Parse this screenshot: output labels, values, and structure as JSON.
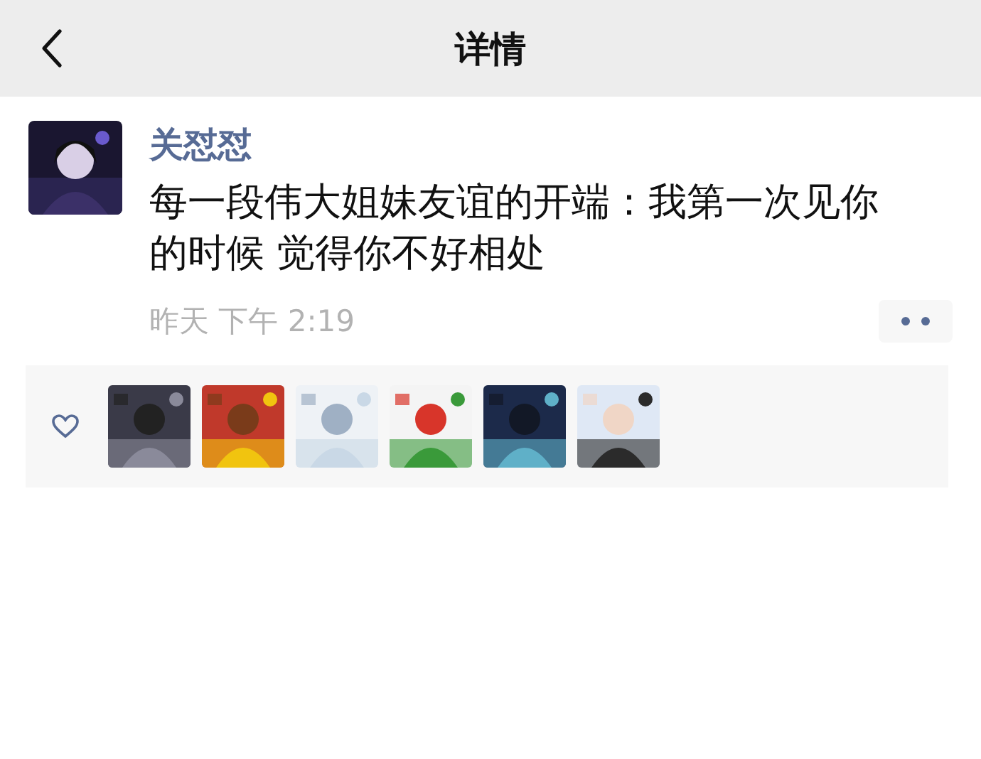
{
  "window": {
    "title": "详情"
  },
  "post": {
    "name": "关怼怼",
    "text": "每一段伟大姐妹友谊的开端：我第一次见你的时候 觉得你不好相处",
    "time": "昨天 下午 2:19"
  }
}
